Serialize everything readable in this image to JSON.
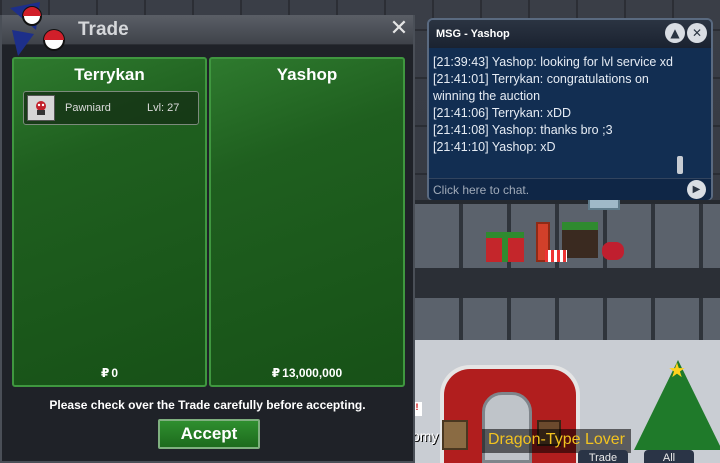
{
  "trade": {
    "title": "Trade",
    "close_icon": "✕",
    "left_panel": {
      "player": "Terrykan",
      "money": "0",
      "items": [
        {
          "pokemon": "Pawniard",
          "level": "Lvl: 27"
        }
      ]
    },
    "right_panel": {
      "player": "Yashop",
      "money": "13,000,000"
    },
    "money_symbol": "₽",
    "note": "Please check over the Trade carefully before accepting.",
    "accept_label": "Accept"
  },
  "chat": {
    "title": "MSG - Yashop",
    "messages": [
      "[21:39:43] Yashop: looking for lvl service xd",
      "[21:41:01] Terrykan: congratulations on winning the auction",
      "[21:41:06] Terrykan: xDD",
      "[21:41:08] Yashop: thanks bro ;3",
      "[21:41:10] Yashop: xD"
    ],
    "input_placeholder": "Click here to chat.",
    "up_icon": "▲",
    "close_icon": "✕",
    "send_icon": "▶"
  },
  "world": {
    "player_title": "Dragon-Type Lover",
    "partial_label": "omy",
    "sign_text": "!",
    "bottom_tabs": [
      "Trade",
      "All"
    ]
  },
  "colors": {
    "panel_green": "#1f5f1f",
    "chat_blue": "#122e52",
    "title_gold": "#f2c320"
  }
}
